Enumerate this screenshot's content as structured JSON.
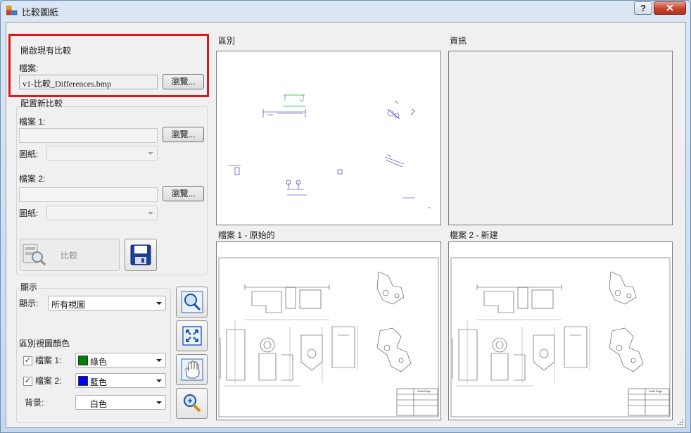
{
  "window": {
    "title": "比較圖紙",
    "help_label": "?",
    "close_label": "✕"
  },
  "open_existing": {
    "legend": "開啟現有比較",
    "file_label": "檔案:",
    "file_value": "v1-比較_Differences.bmp",
    "browse_label": "瀏覽..."
  },
  "new_compare": {
    "legend": "配置新比較",
    "file1_label": "檔案 1:",
    "file1_value": "",
    "browse1_label": "瀏覽...",
    "sheet1_label": "圖紙:",
    "file2_label": "檔案 2:",
    "file2_value": "",
    "browse2_label": "瀏覽...",
    "sheet2_label": "圖紙:",
    "compare_label": "比較"
  },
  "display": {
    "legend": "顯示",
    "show_label": "顯示:",
    "show_value": "所有視圖",
    "diff_color_label": "區別視圖顏色",
    "file1_label": "檔案 1:",
    "file1_checked": true,
    "file1_color_name": "綠色",
    "file1_color": "#008000",
    "file2_label": "檔案 2:",
    "file2_checked": true,
    "file2_color_name": "藍色",
    "file2_color": "#0000ff",
    "bg_label": "背景:",
    "bg_value": "白色"
  },
  "panels": {
    "diff_label": "區別",
    "info_label": "資訊",
    "file1_label": "檔案 1 - 原始的",
    "file2_label": "檔案 2 - 新建"
  },
  "drawing": {
    "title_block_text": "Solid Edge"
  },
  "icons": {
    "app": "app-icon",
    "compare": "compare-magnifier-icon",
    "save": "floppy-disk-icon",
    "zoom_area": "zoom-area-icon",
    "fit": "fit-view-icon",
    "pan": "pan-hand-icon",
    "zoom": "zoom-icon"
  }
}
